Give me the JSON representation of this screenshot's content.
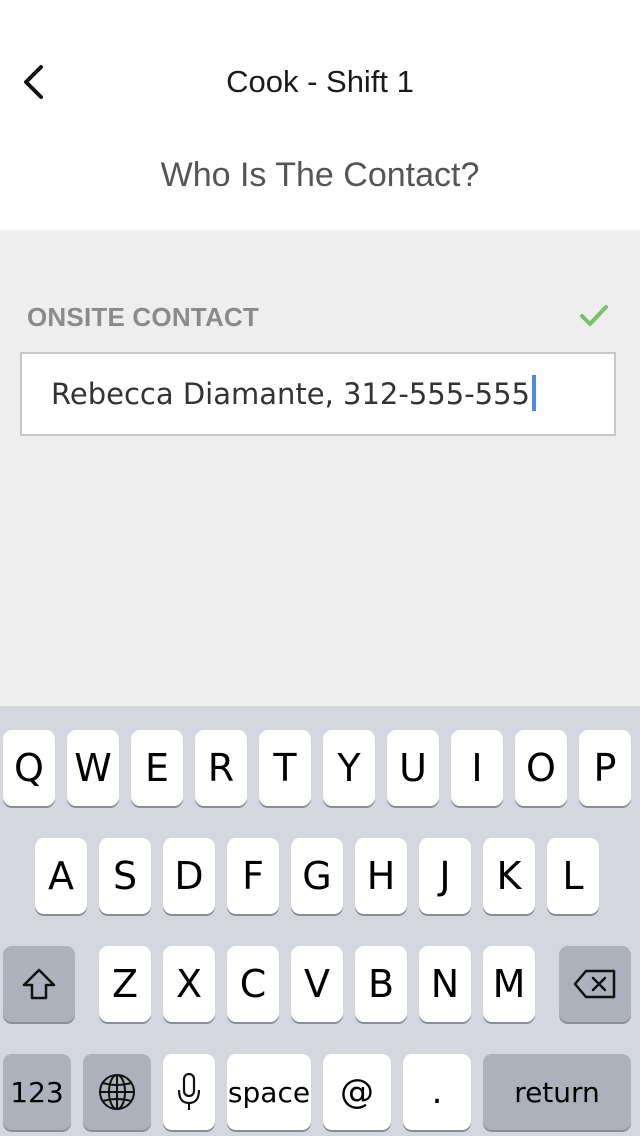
{
  "header": {
    "title": "Cook - Shift 1",
    "question": "Who Is The Contact?"
  },
  "form": {
    "field_label": "ONSITE CONTACT",
    "field_value": "Rebecca Diamante, 312-555-555",
    "check_color": "#7ac06f"
  },
  "keyboard": {
    "row1": [
      "Q",
      "W",
      "E",
      "R",
      "T",
      "Y",
      "U",
      "I",
      "O",
      "P"
    ],
    "row2": [
      "A",
      "S",
      "D",
      "F",
      "G",
      "H",
      "J",
      "K",
      "L"
    ],
    "row3": [
      "Z",
      "X",
      "C",
      "V",
      "B",
      "N",
      "M"
    ],
    "numbers_label": "123",
    "space_label": "space",
    "at_label": "@",
    "period_label": ".",
    "return_label": "return",
    "icons": {
      "shift": "shift-icon",
      "delete": "backspace-icon",
      "globe": "globe-icon",
      "mic": "microphone-icon"
    }
  }
}
